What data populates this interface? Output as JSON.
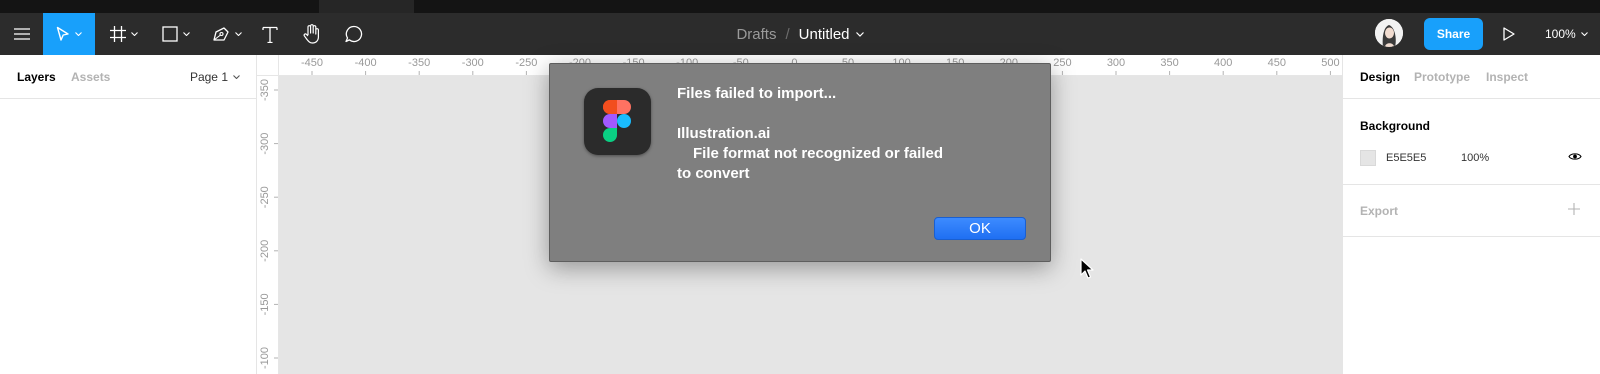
{
  "toolbar": {
    "breadcrumb_parent": "Drafts",
    "breadcrumb_separator": "/",
    "file_title": "Untitled",
    "share_label": "Share",
    "zoom_label": "100%",
    "accent_color": "#18a0fb",
    "icons": [
      "menu-icon",
      "move-icon",
      "frame-icon",
      "rectangle-icon",
      "pen-icon",
      "text-icon",
      "hand-icon",
      "comment-icon",
      "play-icon"
    ]
  },
  "left_panel": {
    "tab_layers": "Layers",
    "tab_assets": "Assets",
    "page_selector": "Page 1"
  },
  "rulers": {
    "horizontal_ticks": [
      "-450",
      "-400",
      "-350",
      "-300",
      "-250",
      "-200",
      "-150",
      "-100",
      "-50",
      "0",
      "50",
      "100",
      "150",
      "200",
      "250",
      "300",
      "350",
      "400",
      "450",
      "500"
    ],
    "vertical_ticks": [
      "-350",
      "-300",
      "-250",
      "-200",
      "-150",
      "-100"
    ]
  },
  "right_panel": {
    "tab_design": "Design",
    "tab_prototype": "Prototype",
    "tab_inspect": "Inspect",
    "background_heading": "Background",
    "background_hex": "E5E5E5",
    "background_opacity": "100%",
    "background_color": "#e5e5e5",
    "export_heading": "Export"
  },
  "dialog": {
    "title": "Files failed to import...",
    "file_name": "Illustration.ai",
    "error_line1": "File format not recognized or failed",
    "error_line2": "to convert",
    "ok_label": "OK"
  }
}
